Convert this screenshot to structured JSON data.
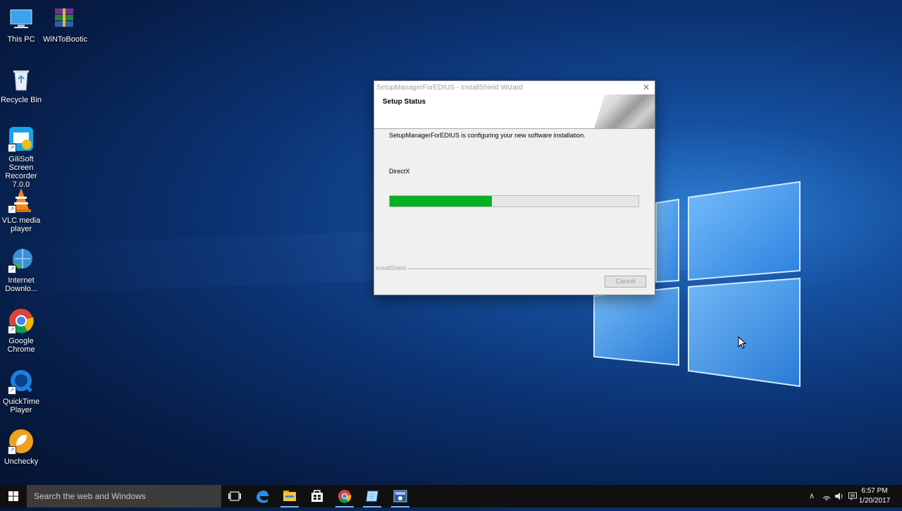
{
  "desktop": {
    "icons": [
      {
        "label": "This PC"
      },
      {
        "label": "WiNToBootic"
      },
      {
        "label": "Recycle Bin"
      },
      {
        "label": "GiliSoft Screen Recorder 7.0.0"
      },
      {
        "label": "VLC media player"
      },
      {
        "label": "Internet Downlo..."
      },
      {
        "label": "Google Chrome"
      },
      {
        "label": "QuickTime Player"
      },
      {
        "label": "Unchecky"
      }
    ]
  },
  "dialog": {
    "title": "SetupManagerForEDIUS - InstallShield Wizard",
    "close_glyph": "✕",
    "header_title": "Setup Status",
    "status_text": "SetupManagerForEDIUS is configuring your new software installation.",
    "component": "DirectX",
    "progress": 0.41,
    "brand": "InstallShield",
    "cancel_label": "Cancel"
  },
  "taskbar": {
    "search_placeholder": "Search the web and Windows",
    "apps": [
      "task-view-icon",
      "edge-icon",
      "file-explorer-icon",
      "store-icon",
      "chrome-icon",
      "app-icon",
      "installer-icon"
    ],
    "time": "6:57 PM",
    "date": "1/20/2017"
  },
  "colors": {
    "progress_fill": "#06b025",
    "taskbar": "#101010"
  }
}
